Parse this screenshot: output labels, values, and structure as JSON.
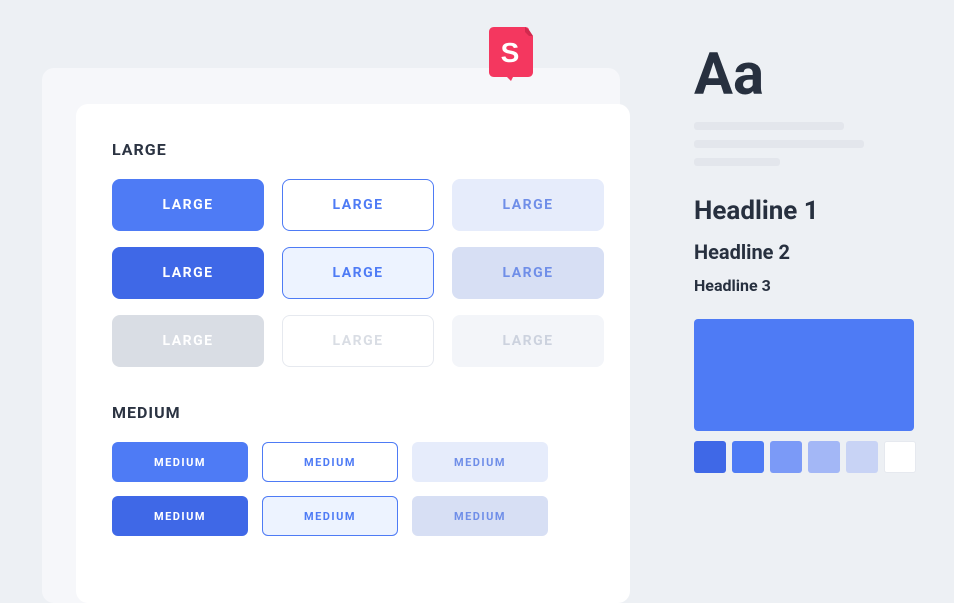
{
  "badge": {
    "letter": "S"
  },
  "sections": {
    "large": {
      "title": "LARGE",
      "buttons": [
        "LARGE",
        "LARGE",
        "LARGE",
        "LARGE",
        "LARGE",
        "LARGE",
        "LARGE",
        "LARGE",
        "LARGE"
      ]
    },
    "medium": {
      "title": "MEDIUM",
      "buttons": [
        "MEDIUM",
        "MEDIUM",
        "MEDIUM",
        "MEDIUM",
        "MEDIUM",
        "MEDIUM"
      ]
    }
  },
  "typo": {
    "sample": "Aa",
    "h1": "Headline 1",
    "h2": "Headline 2",
    "h3": "Headline 3"
  },
  "swatches": {
    "colors": [
      "#3f68e7",
      "#4e7bf5",
      "#7b9af7",
      "#a3b7f6",
      "#c8d3f5",
      "#ffffff"
    ]
  }
}
